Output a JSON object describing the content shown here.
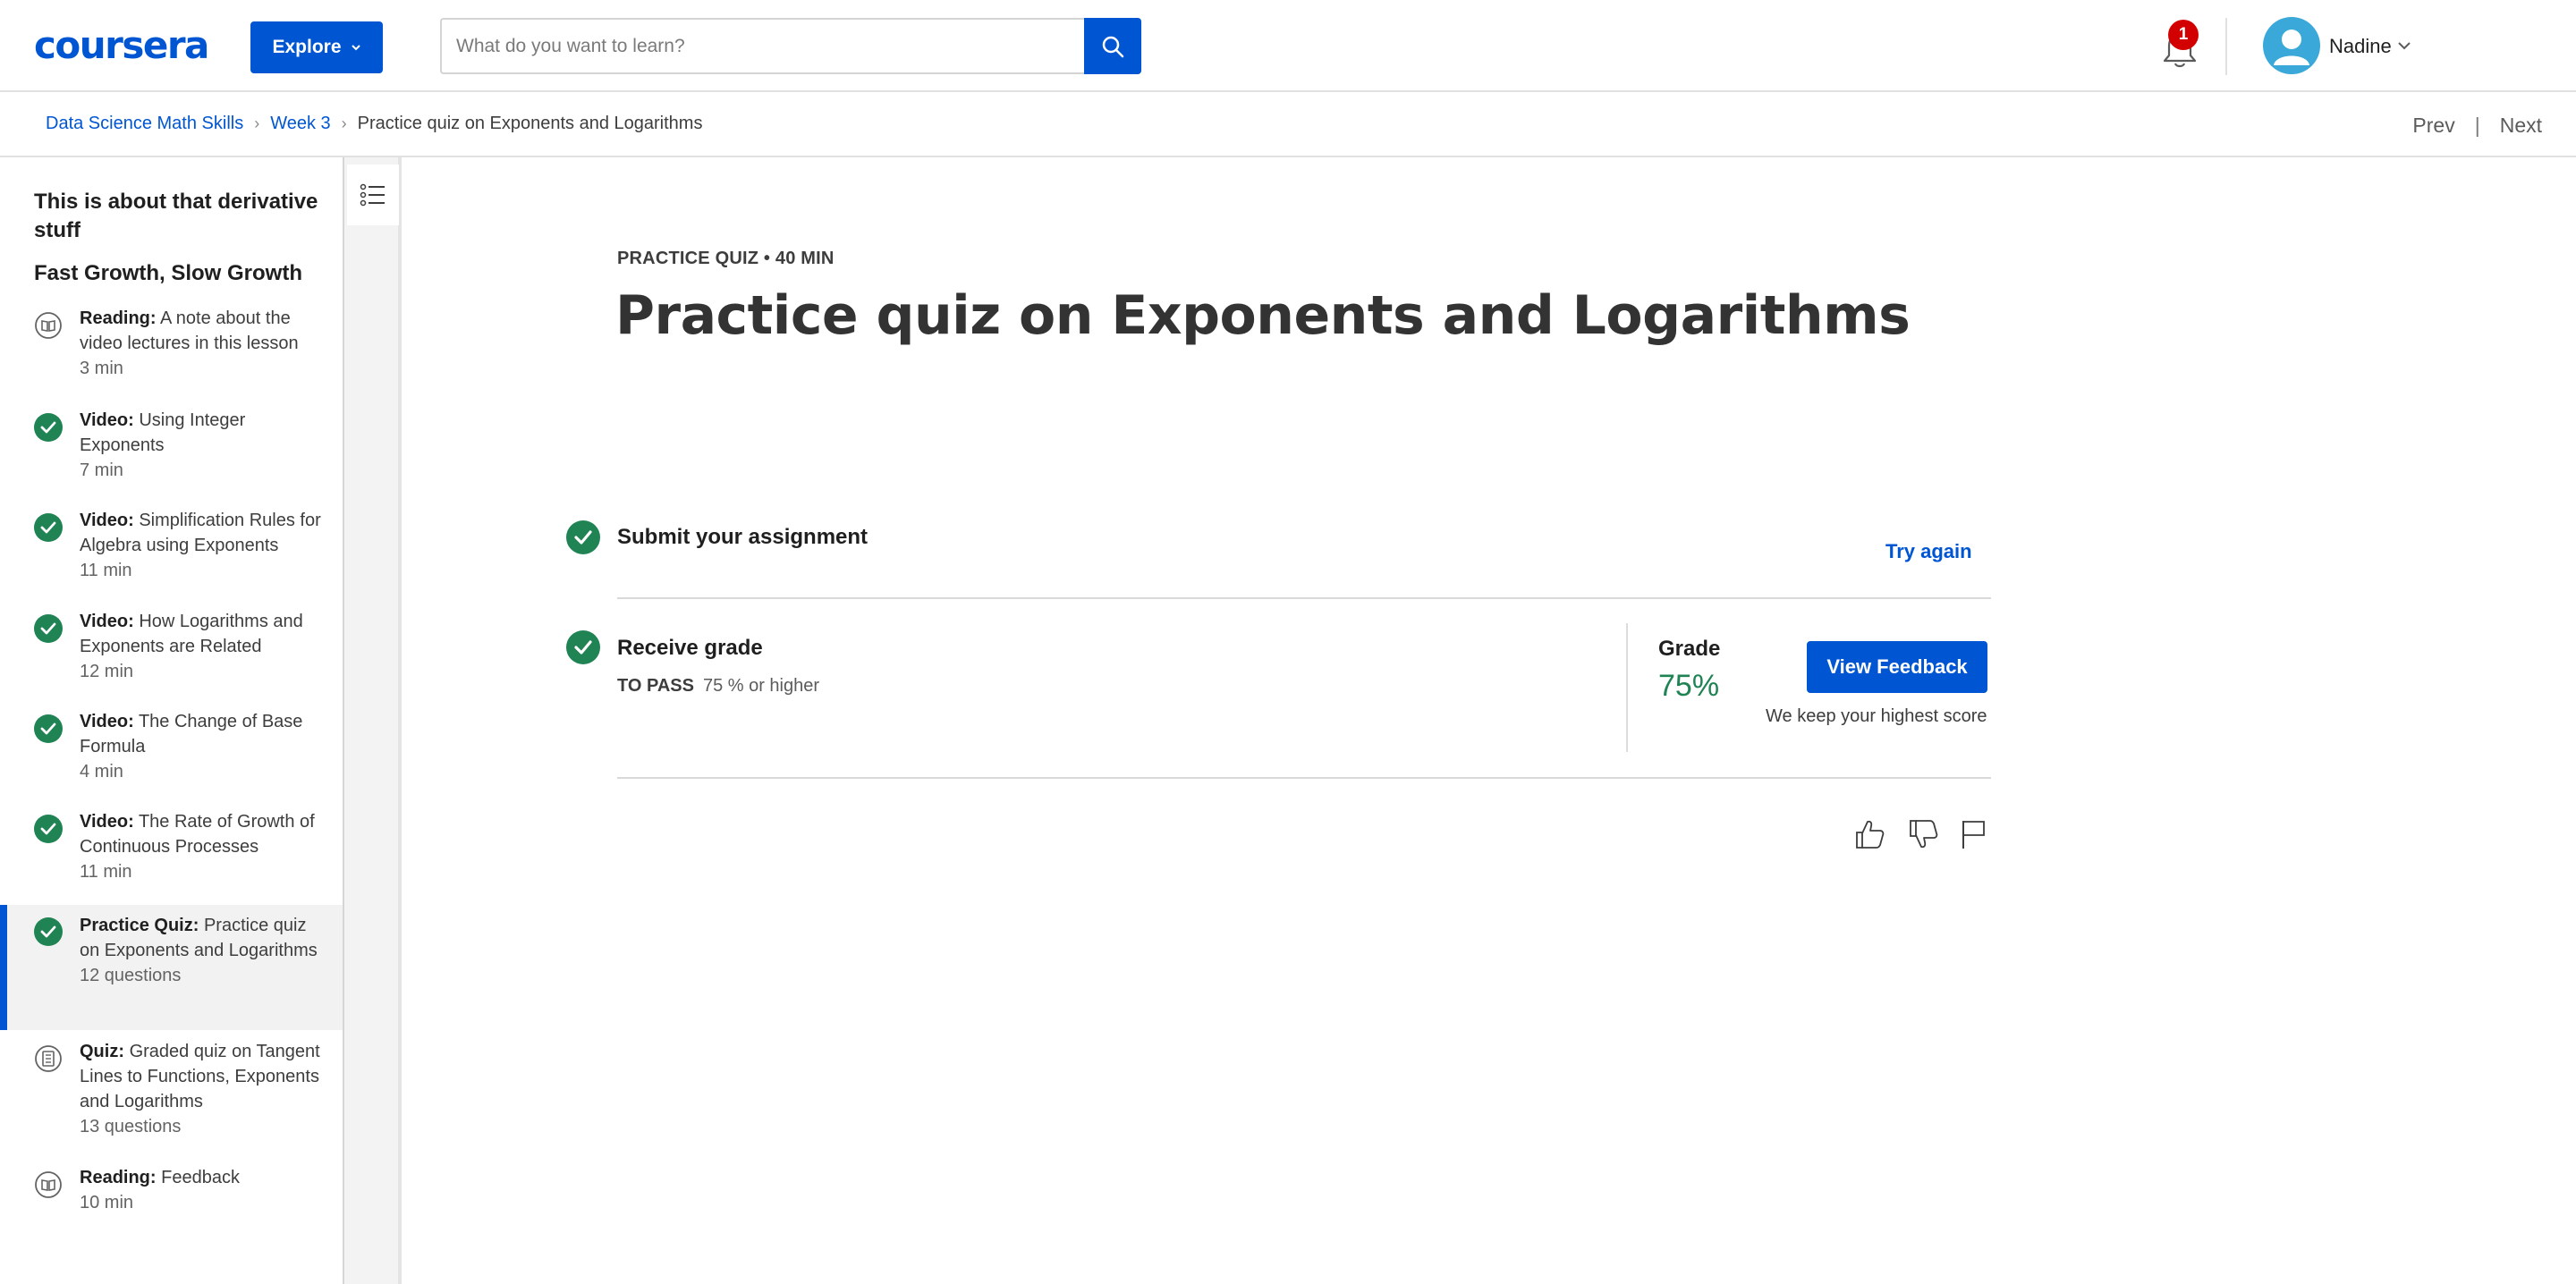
{
  "header": {
    "logo": "coursera",
    "explore_label": "Explore",
    "search_placeholder": "What do you want to learn?",
    "search_value": "",
    "notification_count": "1",
    "user_name": "Nadine"
  },
  "breadcrumb": {
    "items": [
      "Data Science Math Skills",
      "Week 3",
      "Practice quiz on Exponents and Logarithms"
    ],
    "prev": "Prev",
    "next": "Next"
  },
  "sidebar": {
    "module_title": "This is about that derivative stuff",
    "lesson_title": "Fast Growth, Slow Growth",
    "items": [
      {
        "kind": "Reading:",
        "title": "A note about the video lectures in this lesson",
        "meta": "3 min",
        "status": "reading"
      },
      {
        "kind": "Video:",
        "title": "Using Integer Exponents",
        "meta": "7 min",
        "status": "done"
      },
      {
        "kind": "Video:",
        "title": "Simplification Rules for Algebra using Exponents",
        "meta": "11 min",
        "status": "done"
      },
      {
        "kind": "Video:",
        "title": "How Logarithms and Exponents are Related",
        "meta": "12 min",
        "status": "done"
      },
      {
        "kind": "Video:",
        "title": "The Change of Base Formula",
        "meta": "4 min",
        "status": "done"
      },
      {
        "kind": "Video:",
        "title": "The Rate of Growth of Continuous Processes",
        "meta": "11 min",
        "status": "done"
      },
      {
        "kind": "Practice Quiz:",
        "title": "Practice quiz on Exponents and Logarithms",
        "meta": "12 questions",
        "status": "done-active"
      },
      {
        "kind": "Quiz:",
        "title": "Graded quiz on Tangent Lines to Functions, Exponents and Logarithms",
        "meta": "13 questions",
        "status": "quiz"
      },
      {
        "kind": "Reading:",
        "title": "Feedback",
        "meta": "10 min",
        "status": "reading"
      }
    ]
  },
  "main": {
    "kicker": "PRACTICE QUIZ • 40 MIN",
    "title": "Practice quiz on Exponents and Logarithms",
    "submit_title": "Submit your assignment",
    "try_again": "Try again",
    "receive_title": "Receive grade",
    "to_pass_label": "TO PASS",
    "to_pass_value": "75 % or higher",
    "grade_label": "Grade",
    "grade_value": "75%",
    "view_feedback": "View Feedback",
    "keep_score": "We keep your highest score"
  },
  "colors": {
    "brand": "#0056d2",
    "success": "#1f8354",
    "badge": "#d30001"
  },
  "icons": [
    "search-icon",
    "bell-icon",
    "user-avatar-icon",
    "chevron-down-icon",
    "list-icon",
    "check-circle-icon",
    "book-icon",
    "quiz-icon",
    "thumbs-up-icon",
    "thumbs-down-icon",
    "flag-icon"
  ]
}
